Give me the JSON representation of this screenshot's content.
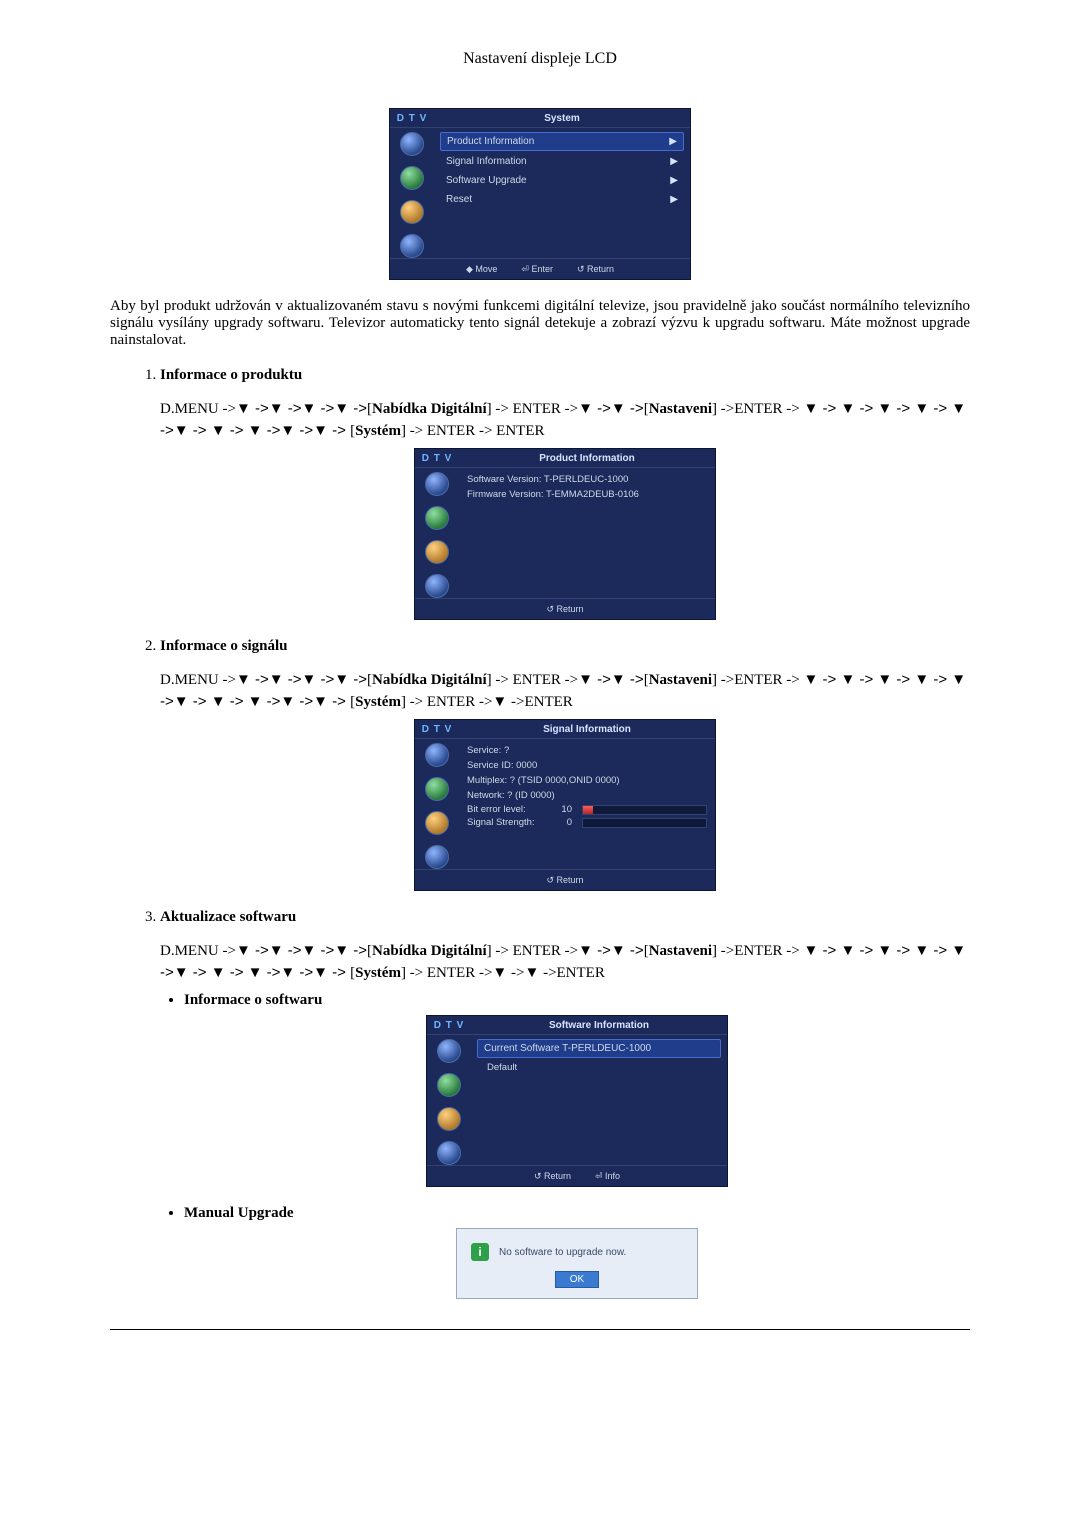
{
  "page_title": "Nastavení displeje LCD",
  "osd_brand": "D T V",
  "osd1": {
    "title": "System",
    "items": [
      "Product Information",
      "Signal Information",
      "Software Upgrade",
      "Reset"
    ],
    "foot_move": "◆ Move",
    "foot_enter": "⏎ Enter",
    "foot_return": "↺ Return"
  },
  "intro": "Aby byl produkt udržován v aktualizovaném stavu s novými funkcemi digitální televize, jsou pravidelně jako součást normálního televizního signálu vysílány upgrady softwaru. Televizor automaticky tento signál detekuje a zobrazí výzvu k upgradu softwaru. Máte možnost upgrade nainstalovat.",
  "sec1": {
    "title": "Informace o produktu",
    "path_dmenu": "D.MENU ->",
    "path_digital": "Nabídka Digitální",
    "path_enter": " -> ENTER ->",
    "path_settings": "Nastaveni",
    "path_enter2": " ->ENTER -> ",
    "path_system": "Systém",
    "path_tail": " -> ENTER -> ENTER"
  },
  "osd2": {
    "title": "Product Information",
    "l1": "Software Version: T-PERLDEUC-1000",
    "l2": "Firmware Version: T-EMMA2DEUB-0106",
    "foot": "↺ Return"
  },
  "sec2": {
    "title": "Informace o signálu",
    "path_tail": " -> ENTER ->▼ ->ENTER"
  },
  "osd3": {
    "title": "Signal Information",
    "l1": "Service: ?",
    "l2": "Service ID: 0000",
    "l3": "Multiplex: ? (TSID 0000,ONID 0000)",
    "l4": "Network: ? (ID 0000)",
    "bit_label": "Bit error level:",
    "bit_val": "10",
    "sig_label": "Signal Strength:",
    "sig_val": "0",
    "foot": "↺ Return"
  },
  "sec3": {
    "title": "Aktualizace softwaru",
    "path_tail": " -> ENTER ->▼ ->▼ ->ENTER"
  },
  "sec3a_title": "Informace o softwaru",
  "osd4": {
    "title": "Software Information",
    "l1": "Current Software T-PERLDEUC-1000",
    "l2": "Default",
    "foot_return": "↺ Return",
    "foot_info": "⏎ Info"
  },
  "sec3b_title": "Manual Upgrade",
  "popup": {
    "icon": "i",
    "text": "No software to upgrade now.",
    "ok": "OK"
  }
}
